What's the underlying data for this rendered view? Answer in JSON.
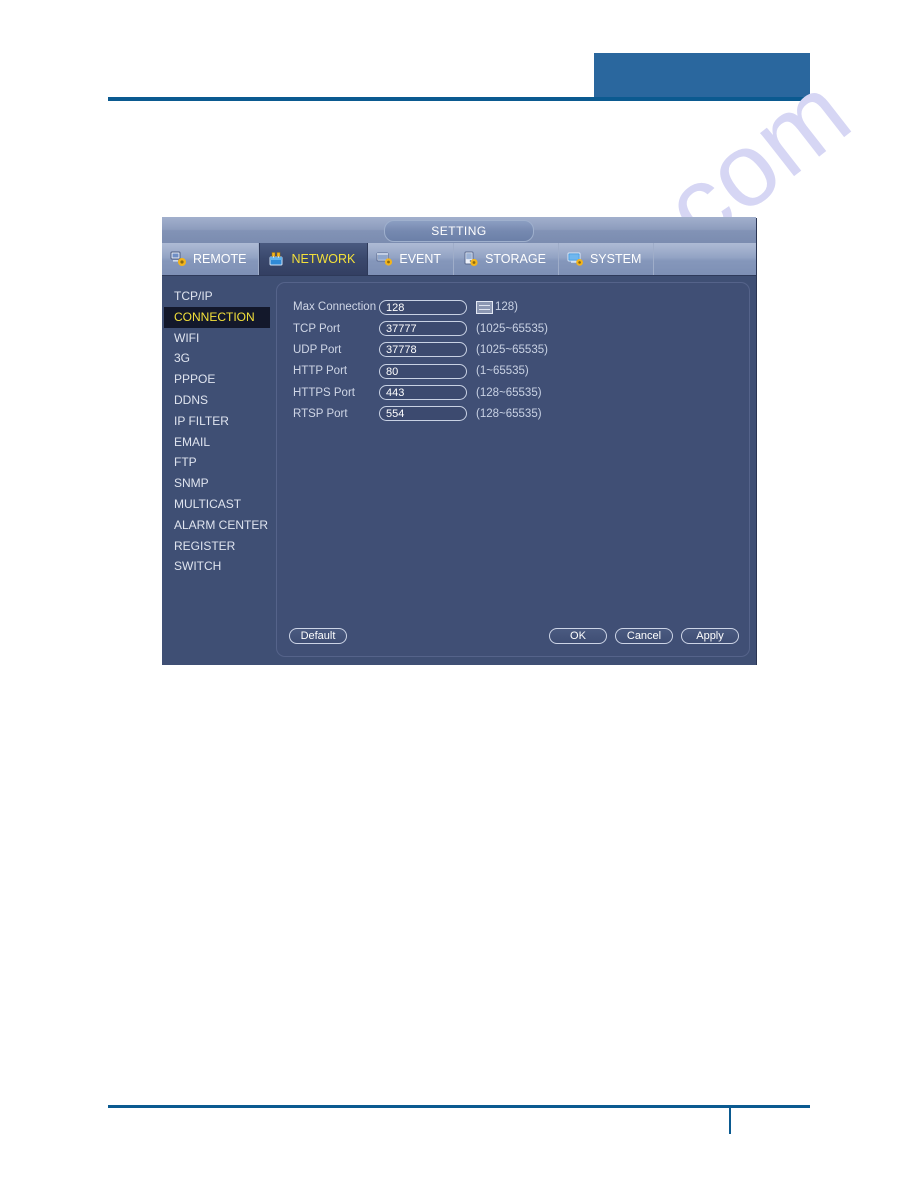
{
  "watermark": {
    "text": "manualshive.com"
  },
  "dialog": {
    "title": "SETTING",
    "tabs": [
      {
        "label": "REMOTE",
        "icon": "remote-gear-icon",
        "active": false
      },
      {
        "label": "NETWORK",
        "icon": "network-gear-icon",
        "active": true
      },
      {
        "label": "EVENT",
        "icon": "event-gear-icon",
        "active": false
      },
      {
        "label": "STORAGE",
        "icon": "storage-gear-icon",
        "active": false
      },
      {
        "label": "SYSTEM",
        "icon": "system-gear-icon",
        "active": false
      }
    ],
    "sidebar": {
      "items": [
        {
          "label": "TCP/IP",
          "selected": false
        },
        {
          "label": "CONNECTION",
          "selected": true
        },
        {
          "label": "WIFI",
          "selected": false
        },
        {
          "label": "3G",
          "selected": false
        },
        {
          "label": "PPPOE",
          "selected": false
        },
        {
          "label": "DDNS",
          "selected": false
        },
        {
          "label": "IP FILTER",
          "selected": false
        },
        {
          "label": "EMAIL",
          "selected": false
        },
        {
          "label": "FTP",
          "selected": false
        },
        {
          "label": "SNMP",
          "selected": false
        },
        {
          "label": "MULTICAST",
          "selected": false
        },
        {
          "label": "ALARM CENTER",
          "selected": false
        },
        {
          "label": "REGISTER",
          "selected": false
        },
        {
          "label": "SWITCH",
          "selected": false
        }
      ]
    },
    "form": {
      "rows": [
        {
          "label": "Max Connection",
          "value": "128",
          "hint": "128)",
          "has_box_glyph": true
        },
        {
          "label": "TCP Port",
          "value": "37777",
          "hint": "(1025~65535)",
          "has_box_glyph": false
        },
        {
          "label": "UDP Port",
          "value": "37778",
          "hint": "(1025~65535)",
          "has_box_glyph": false
        },
        {
          "label": "HTTP Port",
          "value": "80",
          "hint": "(1~65535)",
          "has_box_glyph": false
        },
        {
          "label": "HTTPS Port",
          "value": "443",
          "hint": "(128~65535)",
          "has_box_glyph": false
        },
        {
          "label": "RTSP Port",
          "value": "554",
          "hint": "(128~65535)",
          "has_box_glyph": false
        }
      ]
    },
    "buttons": {
      "default_label": "Default",
      "ok_label": "OK",
      "cancel_label": "Cancel",
      "apply_label": "Apply"
    }
  },
  "colors": {
    "accent_blue": "#0b5a90",
    "header_block": "#2a679e",
    "dialog_bg": "#3f4f74",
    "selected_item_bg": "#13182b",
    "highlight_text": "#f3e03a",
    "watermark": "#d6d6f4"
  }
}
